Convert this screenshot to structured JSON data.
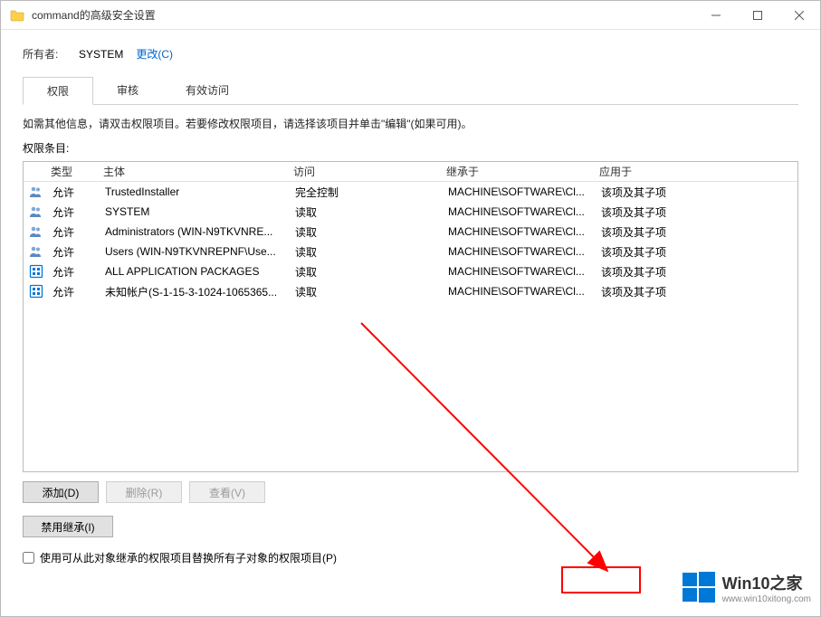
{
  "title": "command的高级安全设置",
  "owner": {
    "label": "所有者:",
    "value": "SYSTEM",
    "change_link": "更改(C)"
  },
  "tabs": [
    {
      "label": "权限",
      "active": true
    },
    {
      "label": "审核",
      "active": false
    },
    {
      "label": "有效访问",
      "active": false
    }
  ],
  "info_text": "如需其他信息，请双击权限项目。若要修改权限项目，请选择该项目并单击\"编辑\"(如果可用)。",
  "list_label": "权限条目:",
  "columns": {
    "type": "类型",
    "principal": "主体",
    "access": "访问",
    "inherited": "继承于",
    "applies": "应用于"
  },
  "entries": [
    {
      "icon": "group",
      "type": "允许",
      "principal": "TrustedInstaller",
      "access": "完全控制",
      "inherited": "MACHINE\\SOFTWARE\\Cl...",
      "applies": "该项及其子项"
    },
    {
      "icon": "group",
      "type": "允许",
      "principal": "SYSTEM",
      "access": "读取",
      "inherited": "MACHINE\\SOFTWARE\\Cl...",
      "applies": "该项及其子项"
    },
    {
      "icon": "group",
      "type": "允许",
      "principal": "Administrators (WIN-N9TKVNRE...",
      "access": "读取",
      "inherited": "MACHINE\\SOFTWARE\\Cl...",
      "applies": "该项及其子项"
    },
    {
      "icon": "group",
      "type": "允许",
      "principal": "Users (WIN-N9TKVNREPNF\\Use...",
      "access": "读取",
      "inherited": "MACHINE\\SOFTWARE\\Cl...",
      "applies": "该项及其子项"
    },
    {
      "icon": "package",
      "type": "允许",
      "principal": "ALL APPLICATION PACKAGES",
      "access": "读取",
      "inherited": "MACHINE\\SOFTWARE\\Cl...",
      "applies": "该项及其子项"
    },
    {
      "icon": "package",
      "type": "允许",
      "principal": "未知帐户(S-1-15-3-1024-1065365...",
      "access": "读取",
      "inherited": "MACHINE\\SOFTWARE\\Cl...",
      "applies": "该项及其子项"
    }
  ],
  "buttons": {
    "add": "添加(D)",
    "remove": "删除(R)",
    "view": "查看(V)",
    "disable_inherit": "禁用继承(I)"
  },
  "replace_checkbox": "使用可从此对象继承的权限项目替换所有子对象的权限项目(P)",
  "watermark": {
    "title": "Win10之家",
    "url": "www.win10xitong.com"
  }
}
